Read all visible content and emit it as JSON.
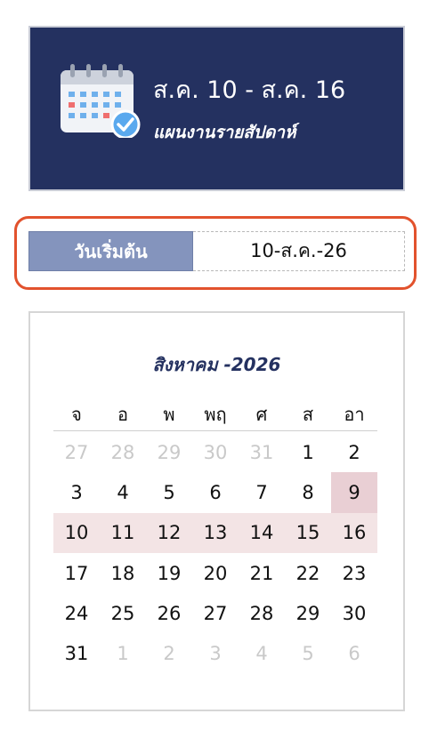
{
  "header": {
    "title": "ส.ค. 10 - ส.ค. 16",
    "subtitle": "แผนงานรายสัปดาห์",
    "icon": "calendar-check-icon",
    "background": "#243160"
  },
  "start_date": {
    "label": "วันเริ่มต้น",
    "value": "10-ส.ค.-26",
    "highlight_color": "#e2522d"
  },
  "calendar": {
    "month_title": "สิงหาคม -2026",
    "weekdays": [
      "จ",
      "อ",
      "พ",
      "พฤ",
      "ศ",
      "ส",
      "อา"
    ],
    "week_highlight_color": "#f3e4e5",
    "selected_color": "#e9cfd4",
    "weeks": [
      [
        {
          "d": "27",
          "s": "other"
        },
        {
          "d": "28",
          "s": "other"
        },
        {
          "d": "29",
          "s": "other"
        },
        {
          "d": "30",
          "s": "other"
        },
        {
          "d": "31",
          "s": "other"
        },
        {
          "d": "1",
          "s": ""
        },
        {
          "d": "2",
          "s": ""
        }
      ],
      [
        {
          "d": "3",
          "s": ""
        },
        {
          "d": "4",
          "s": ""
        },
        {
          "d": "5",
          "s": ""
        },
        {
          "d": "6",
          "s": ""
        },
        {
          "d": "7",
          "s": ""
        },
        {
          "d": "8",
          "s": ""
        },
        {
          "d": "9",
          "s": "selected"
        }
      ],
      [
        {
          "d": "10",
          "s": "week"
        },
        {
          "d": "11",
          "s": "week"
        },
        {
          "d": "12",
          "s": "week"
        },
        {
          "d": "13",
          "s": "week"
        },
        {
          "d": "14",
          "s": "week"
        },
        {
          "d": "15",
          "s": "week"
        },
        {
          "d": "16",
          "s": "week"
        }
      ],
      [
        {
          "d": "17",
          "s": ""
        },
        {
          "d": "18",
          "s": ""
        },
        {
          "d": "19",
          "s": ""
        },
        {
          "d": "20",
          "s": ""
        },
        {
          "d": "21",
          "s": ""
        },
        {
          "d": "22",
          "s": ""
        },
        {
          "d": "23",
          "s": ""
        }
      ],
      [
        {
          "d": "24",
          "s": ""
        },
        {
          "d": "25",
          "s": ""
        },
        {
          "d": "26",
          "s": ""
        },
        {
          "d": "27",
          "s": ""
        },
        {
          "d": "28",
          "s": ""
        },
        {
          "d": "29",
          "s": ""
        },
        {
          "d": "30",
          "s": ""
        }
      ],
      [
        {
          "d": "31",
          "s": ""
        },
        {
          "d": "1",
          "s": "other"
        },
        {
          "d": "2",
          "s": "other"
        },
        {
          "d": "3",
          "s": "other"
        },
        {
          "d": "4",
          "s": "other"
        },
        {
          "d": "5",
          "s": "other"
        },
        {
          "d": "6",
          "s": "other"
        }
      ]
    ]
  }
}
